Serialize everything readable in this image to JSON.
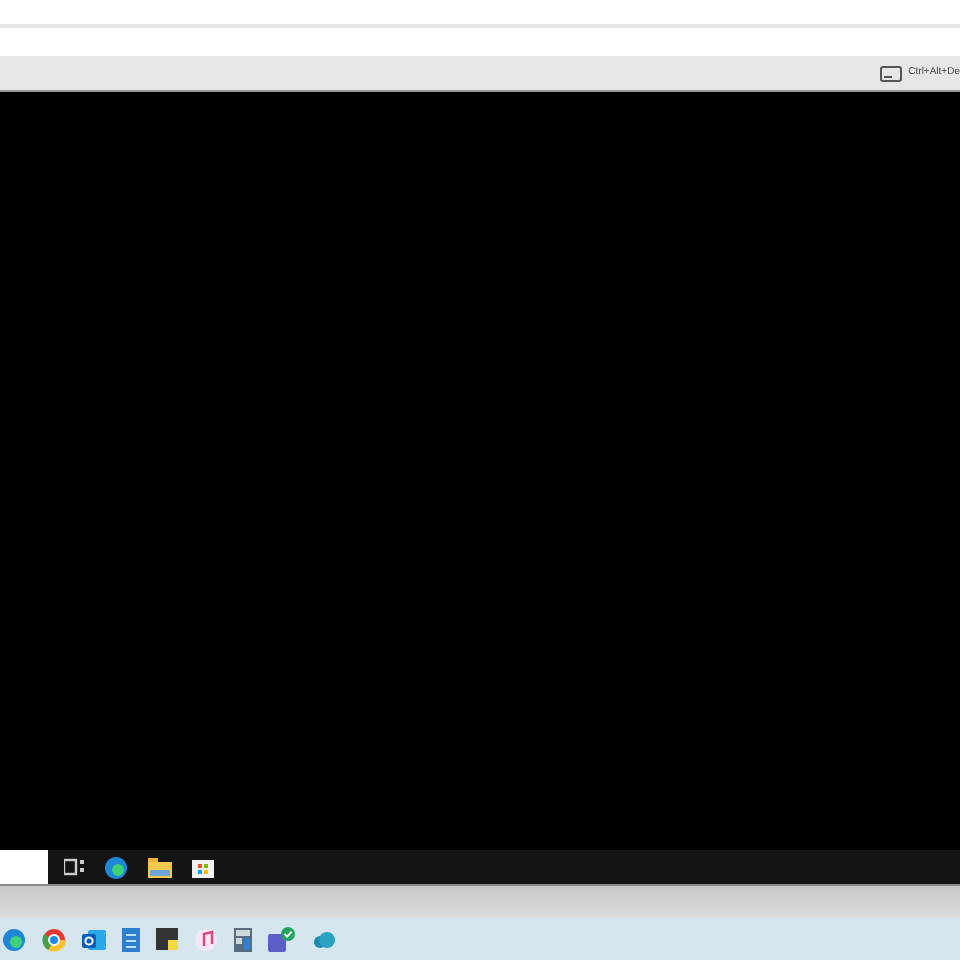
{
  "toolbar": {
    "ctrl_alt_del_label": "Ctrl+Alt+De"
  }
}
